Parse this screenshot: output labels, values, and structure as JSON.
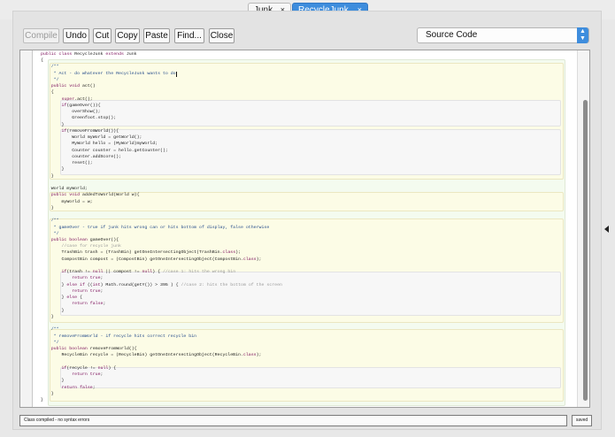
{
  "tabs": [
    {
      "label": "Junk",
      "close": "×",
      "active": false
    },
    {
      "label": "RecycleJunk",
      "close": "×",
      "active": true
    }
  ],
  "toolbar": {
    "compile": "Compile",
    "undo": "Undo",
    "cut": "Cut",
    "copy": "Copy",
    "paste": "Paste",
    "find": "Find...",
    "close": "Close"
  },
  "view_select": {
    "value": "Source Code",
    "arrow_up": "▲",
    "arrow_down": "▼"
  },
  "code_lines": [
    "public class RecycleJunk extends Junk",
    "{",
    "    /**",
    "     * Act - do whatever the RecycleJunk wants to do",
    "     */",
    "    public void act()",
    "    {",
    "        super.act();",
    "        if(gameOver()){",
    "            overShow();",
    "            Greenfoot.stop();",
    "        }",
    "        if(removeFromWorld()){",
    "            World myWorld = getWorld();",
    "            MyWorld hello = (MyWorld)myWorld;",
    "            Counter counter = hello.getCounter();",
    "            counter.addScore();",
    "            reset();",
    "        }",
    "    }",
    "",
    "    World myWorld;",
    "    public void addedToWorld(World w){",
    "        myWorld = w;",
    "    }",
    "",
    "    /**",
    "     * gameOver - true if junk hits wrong can or hits bottom of display, false otherwise",
    "     */",
    "    public boolean gameOver(){",
    "        //case for recycle junk",
    "        TrashBin trash = (TrashBin) getOneIntersectingObject(TrashBin.class);",
    "        CompostBin compost = (CompostBin) getOneIntersectingObject(CompostBin.class);",
    "",
    "        if(trash != null || compost != null) { //case 1: hits the wrong bin",
    "            return true;",
    "        } else if ((int) Math.round(getY()) > 395 ) { //case 2: hits the bottom of the screen",
    "            return true;",
    "        } else {",
    "            return false;",
    "        }",
    "    }",
    "",
    "    /**",
    "     * removeFromWorld - if recycle hits correct recycle bin",
    "     */",
    "    public boolean removeFromWorld(){",
    "        RecycleBin recycle = (RecycleBin) getOneIntersectingObject(RecycleBin.class);",
    "",
    "        if(recycle != null) {",
    "            return true;",
    "        }",
    "        return false;",
    "    }",
    "}"
  ],
  "status": {
    "message": "Class compiled - no syntax errors",
    "saved": "saved"
  },
  "colors": {
    "accent": "#3e8ddd",
    "keyword": "#7a0b58",
    "comment": "#9a9a9a",
    "class_scope": "#f4fbef",
    "method_scope": "#fcfce6",
    "inner_scope": "#f7f7f7"
  },
  "icons": {
    "side_toggle": "triangle-left-icon"
  }
}
